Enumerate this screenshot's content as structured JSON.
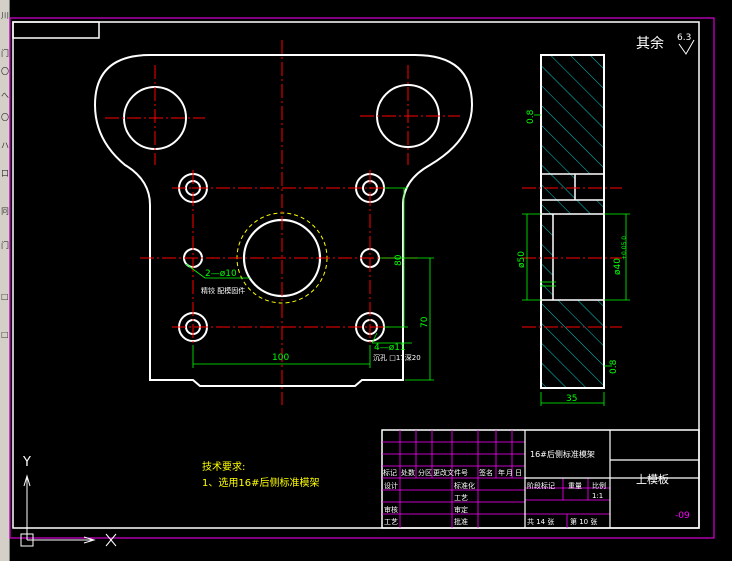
{
  "roughness": {
    "label": "其余",
    "value": "6.3"
  },
  "dimensions": {
    "width_100": "100",
    "height_80": "80",
    "height_70": "70",
    "holes_2x10": "2—ø10",
    "holes_2x10_note": "精铰 配模固件",
    "holes_4x11": "4—ø11",
    "holes_4x11_note": "沉孔 □17深20",
    "thickness_35": "35",
    "bore_50": "ø50",
    "bore_40": "ø40",
    "bore_40_tol": "+0.05 0",
    "roughness_side": "0.8",
    "chamfer_bottom": "0.8"
  },
  "tech_notes": {
    "title": "技术要求:",
    "line1": "1、选用16#后侧标准模架"
  },
  "title_block": {
    "project": "16#后侧标准模架",
    "part_name": "上模板",
    "code": "-09",
    "change_row": [
      "标记",
      "处数",
      "分区",
      "更改文件号",
      "签名",
      "年",
      "月",
      "日"
    ],
    "design": "设计",
    "standardize": "标准化",
    "check": "审核",
    "craft": "工艺",
    "process": "审定",
    "approve": "批准",
    "stage_label": "阶段标记",
    "weight_label": "重量",
    "scale_label": "比例",
    "scale_value": "1:1",
    "sheets_total": "共 14 张",
    "sheet_no": "第 10 张"
  },
  "ucs": {
    "y": "Y",
    "x": "X"
  },
  "toolbar_glyphs": [
    "川",
    "门",
    "〇",
    "へ",
    "〇",
    "ハ",
    "口",
    "冋",
    "门",
    "□",
    "□"
  ]
}
